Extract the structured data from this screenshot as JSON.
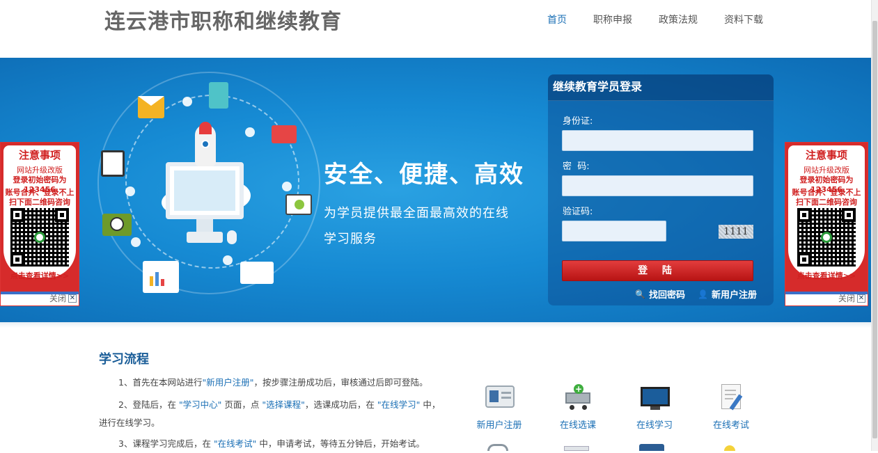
{
  "header": {
    "site_title": "连云港市职称和继续教育",
    "nav": [
      "首页",
      "职称申报",
      "政策法规",
      "资料下载"
    ]
  },
  "banner": {
    "slogan": "安全、便捷、高效",
    "subtitle_line1": "为学员提供最全面最高效的在线",
    "subtitle_line2": "学习服务"
  },
  "login": {
    "title": "继续教育学员登录",
    "id_label": "身份证:",
    "password_label": "密  码:",
    "captcha_label": "验证码:",
    "captcha_text": "1111",
    "submit_label": "登 陆",
    "find_password": "找回密码",
    "register": "新用户注册"
  },
  "notice": {
    "title": "注意事项",
    "line1": "网站升级改版",
    "line2": "登录初始密码为123456",
    "line3": "账号合并、登录不上",
    "line4": "扫下面二维码咨询",
    "footer": "点击查看详情>>",
    "close": "关闭"
  },
  "process": {
    "title": "学习流程",
    "step1": {
      "a": "1、首先在本网站进行",
      "b": "\"新用户注册\"",
      "c": "，按步骤注册成功后，审核通过后即可登陆。"
    },
    "step2": {
      "a": "2、登陆后，在 ",
      "b": "\"学习中心\"",
      "c": " 页面，点 ",
      "d": "\"选择课程\"",
      "e": "，选课成功后，在 ",
      "f": "\"在线学习\"",
      "g": " 中，进行在线学习。"
    },
    "step3": {
      "a": "3、课程学习完成后，在 ",
      "b": "\"在线考试\"",
      "c": " 中，申请考试，等待五分钟后，开始考试。"
    }
  },
  "tools": [
    "新用户注册",
    "在线选课",
    "在线学习",
    "在线考试"
  ],
  "colors": {
    "accent": "#1a6fb5",
    "login_button": "#d32222",
    "banner": "#168ad3"
  }
}
